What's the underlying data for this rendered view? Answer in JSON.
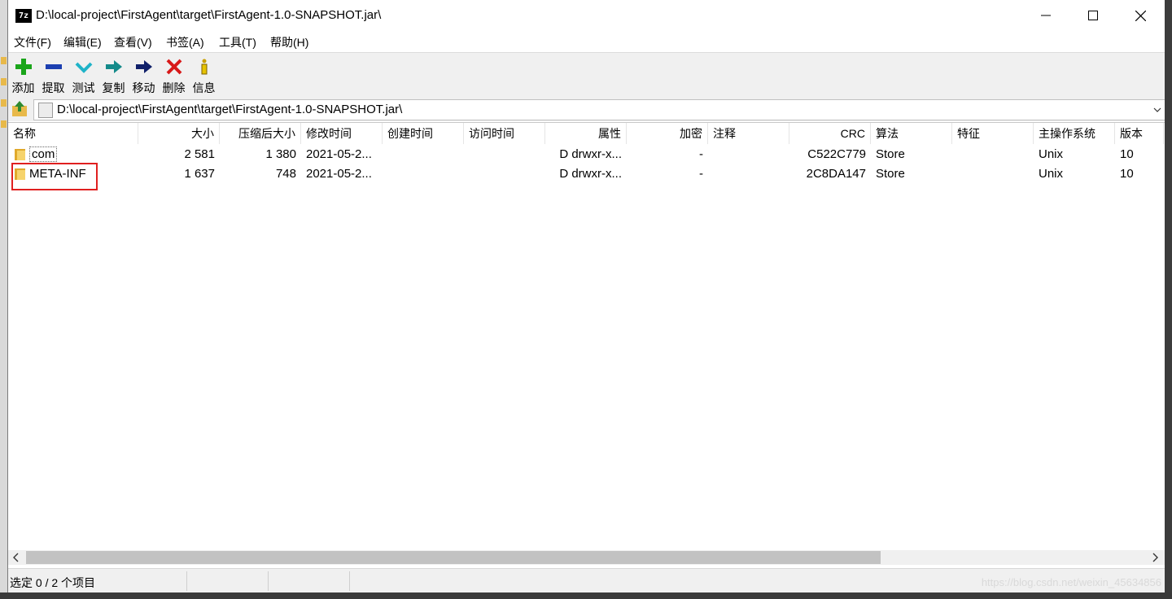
{
  "window": {
    "app_icon": "7z",
    "title": "D:\\local-project\\FirstAgent\\target\\FirstAgent-1.0-SNAPSHOT.jar\\"
  },
  "menu": [
    "文件(F)",
    "编辑(E)",
    "查看(V)",
    "书签(A)",
    "工具(T)",
    "帮助(H)"
  ],
  "toolbar": [
    {
      "label": "添加",
      "icon": "add-icon"
    },
    {
      "label": "提取",
      "icon": "extract-icon"
    },
    {
      "label": "测试",
      "icon": "test-icon"
    },
    {
      "label": "复制",
      "icon": "copy-icon"
    },
    {
      "label": "移动",
      "icon": "move-icon"
    },
    {
      "label": "删除",
      "icon": "delete-icon"
    },
    {
      "label": "信息",
      "icon": "info-icon"
    }
  ],
  "address": "D:\\local-project\\FirstAgent\\target\\FirstAgent-1.0-SNAPSHOT.jar\\",
  "columns": [
    "名称",
    "大小",
    "压缩后大小",
    "修改时间",
    "创建时间",
    "访问时间",
    "属性",
    "加密",
    "注释",
    "CRC",
    "算法",
    "特征",
    "主操作系统",
    "版本"
  ],
  "rows": [
    {
      "name": "com",
      "size": "2 581",
      "packed": "1 380",
      "modified": "2021-05-2...",
      "created": "",
      "accessed": "",
      "attr": "D drwxr-x...",
      "encrypted": "-",
      "comment": "",
      "crc": "C522C779",
      "method": "Store",
      "characteristics": "",
      "host_os": "Unix",
      "version": "10"
    },
    {
      "name": "META-INF",
      "size": "1 637",
      "packed": "748",
      "modified": "2021-05-2...",
      "created": "",
      "accessed": "",
      "attr": "D drwxr-x...",
      "encrypted": "-",
      "comment": "",
      "crc": "2C8DA147",
      "method": "Store",
      "characteristics": "",
      "host_os": "Unix",
      "version": "10"
    }
  ],
  "status": "选定 0 / 2 个项目",
  "watermark": "https://blog.csdn.net/weixin_45634856",
  "colors": {
    "highlight": "#e02020",
    "folder": "#f6d36b"
  }
}
